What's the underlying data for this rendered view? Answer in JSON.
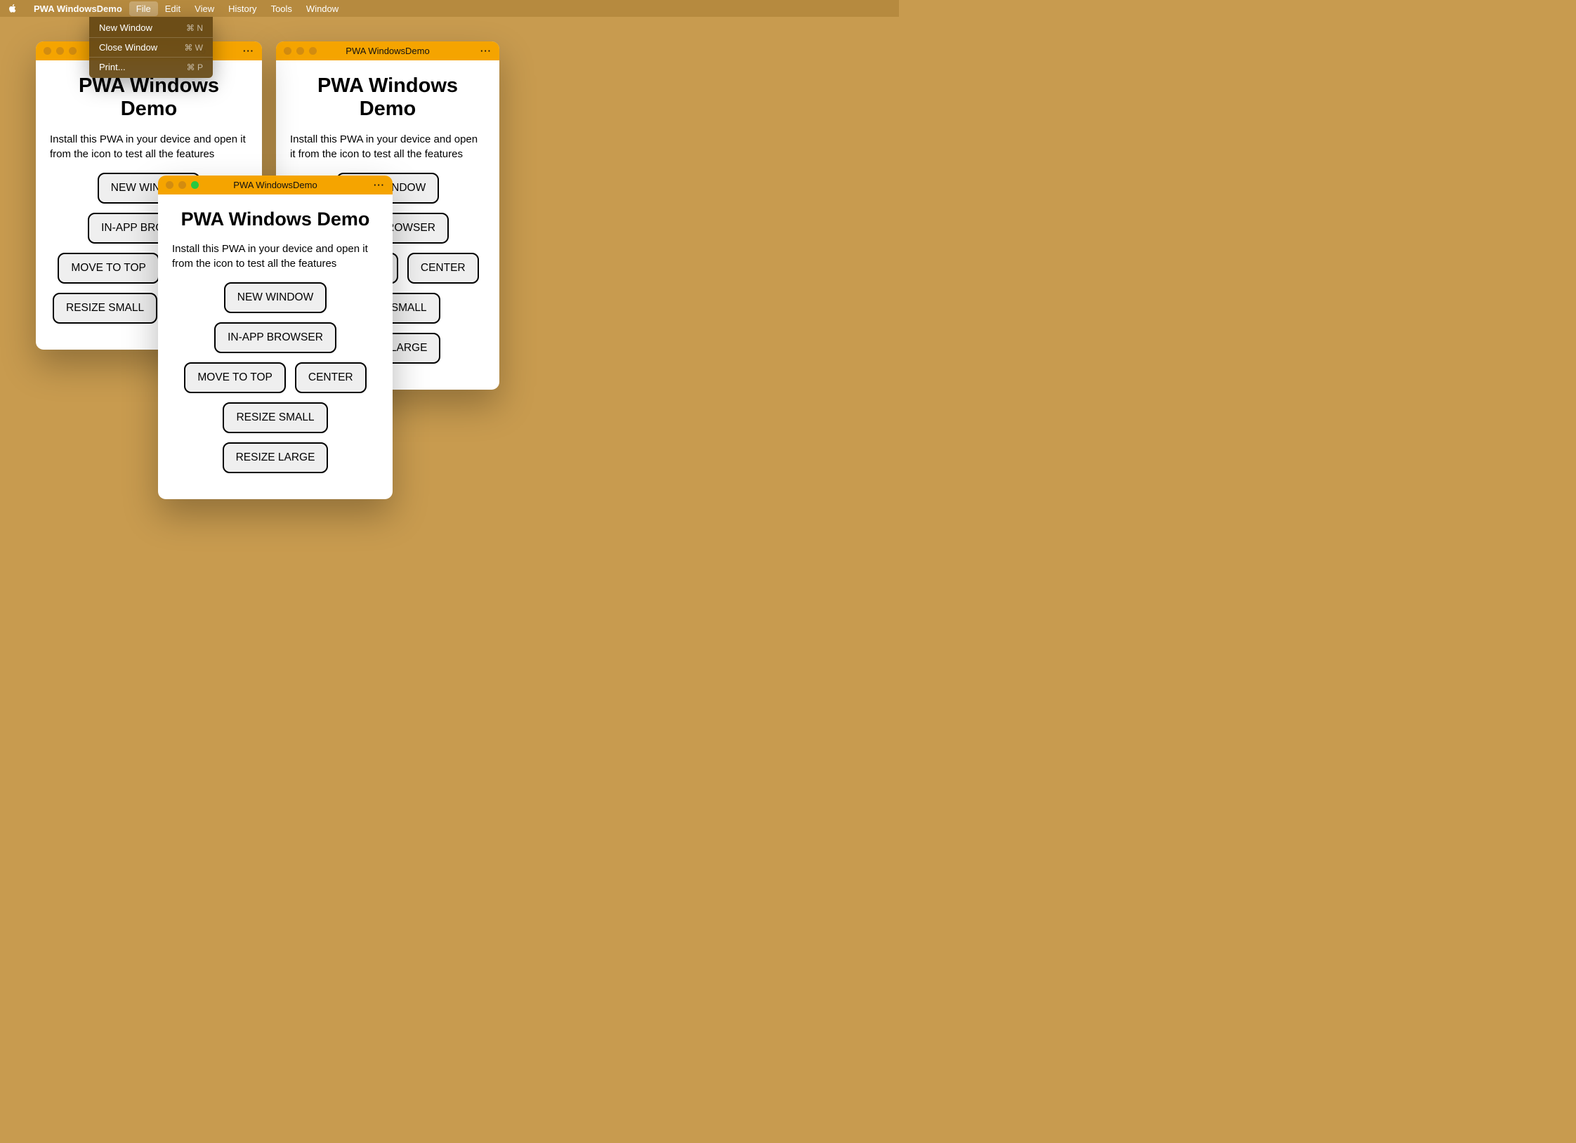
{
  "menubar": {
    "app_name": "PWA WindowsDemo",
    "items": [
      "File",
      "Edit",
      "View",
      "History",
      "Tools",
      "Window"
    ],
    "active_index": 0
  },
  "dropdown": {
    "items": [
      {
        "label": "New Window",
        "shortcut": "⌘ N"
      },
      {
        "label": "Close Window",
        "shortcut": "⌘ W"
      },
      {
        "label": "Print...",
        "shortcut": "⌘ P"
      }
    ]
  },
  "window": {
    "title": "PWA WindowsDemo",
    "heading": "PWA Windows Demo",
    "description": "Install this PWA in your device and open it from the icon to test all the features",
    "buttons": {
      "new_window": "NEW WINDOW",
      "in_app_browser": "IN-APP BROWSER",
      "move_to_top": "MOVE TO TOP",
      "center": "CENTER",
      "resize_small": "RESIZE SMALL",
      "resize_large": "RESIZE LARGE"
    },
    "more_icon": "···"
  }
}
